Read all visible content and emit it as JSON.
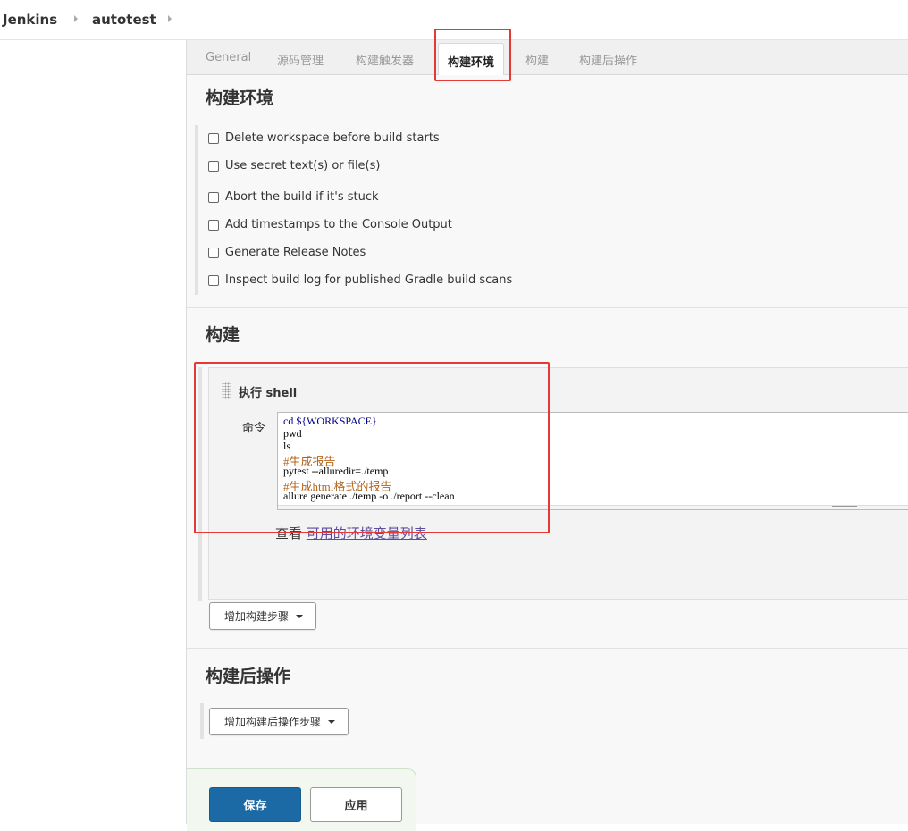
{
  "breadcrumb": {
    "items": [
      "Jenkins",
      "autotest"
    ]
  },
  "tabs": [
    {
      "label": "General",
      "active": false
    },
    {
      "label": "源码管理",
      "active": false
    },
    {
      "label": "构建触发器",
      "active": false
    },
    {
      "label": "构建环境",
      "active": true
    },
    {
      "label": "构建",
      "active": false
    },
    {
      "label": "构建后操作",
      "active": false
    }
  ],
  "build_env": {
    "title": "构建环境",
    "options": [
      {
        "label": "Delete workspace before build starts",
        "checked": false
      },
      {
        "label": "Use secret text(s) or file(s)",
        "checked": false
      },
      {
        "label": "Abort the build if it's stuck",
        "checked": false
      },
      {
        "label": "Add timestamps to the Console Output",
        "checked": false
      },
      {
        "label": "Generate Release Notes",
        "checked": false
      },
      {
        "label": "Inspect build log for published Gradle build scans",
        "checked": false
      }
    ]
  },
  "build": {
    "title": "构建",
    "step_title": "执行 shell",
    "command_label": "命令",
    "command_lines": [
      "cd ${WORKSPACE}",
      "pwd",
      "ls",
      "#生成报告",
      "pytest --alluredir=./temp",
      "#生成html格式的报告",
      "allure generate ./temp -o ./report --clean"
    ],
    "env_prefix": "查看 ",
    "env_link": "可用的环境变量列表",
    "add_step_label": "增加构建步骤"
  },
  "post_build": {
    "title": "构建后操作",
    "add_step_label": "增加构建后操作步骤"
  },
  "actions": {
    "save_label": "保存",
    "apply_label": "应用"
  },
  "colors": {
    "accent": "#1b6aa5",
    "highlight": "#e53935",
    "link": "#5a4ea0"
  }
}
